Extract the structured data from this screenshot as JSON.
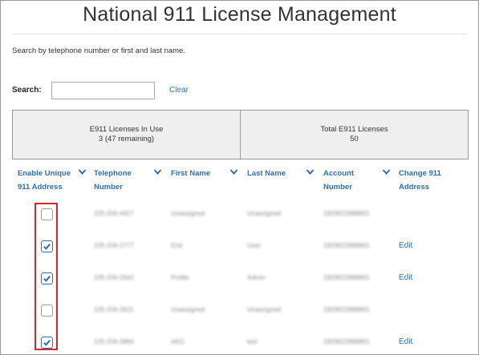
{
  "page": {
    "title": "National 911 License Management",
    "instructions": "Search by telephone number or first and last name."
  },
  "search": {
    "label": "Search:",
    "value": "",
    "placeholder": "",
    "clear_label": "Clear"
  },
  "stats": {
    "in_use_label": "E911 Licenses In Use",
    "in_use_value": "3 (47 remaining)",
    "total_label": "Total E911 Licenses",
    "total_value": "50"
  },
  "columns": {
    "enable_line1": "Enable Unique",
    "enable_line2": "911 Address",
    "phone_line1": "Telephone",
    "phone_line2": "Number",
    "first_name": "First Name",
    "last_name": "Last Name",
    "account_line1": "Account",
    "account_line2": "Number",
    "change_line1": "Change 911",
    "change_line2": "Address"
  },
  "rows": [
    {
      "checked": false,
      "phone": "225-256-4427",
      "first": "Unassigned",
      "last": "Unassigned",
      "account": "1829922988801",
      "edit": ""
    },
    {
      "checked": true,
      "phone": "225-256-2777",
      "first": "End",
      "last": "User",
      "account": "1829922988801",
      "edit": "Edit"
    },
    {
      "checked": true,
      "phone": "225-256-2642",
      "first": "Profile",
      "last": "Admin",
      "account": "1829922988801",
      "edit": "Edit"
    },
    {
      "checked": false,
      "phone": "225-256-3621",
      "first": "Unassigned",
      "last": "Unassigned",
      "account": "1829922988801",
      "edit": ""
    },
    {
      "checked": true,
      "phone": "225-256-3884",
      "first": "e911",
      "last": "test",
      "account": "1829922988801",
      "edit": "Edit"
    }
  ],
  "colors": {
    "link": "#2f6fb3",
    "checkbox_accent": "#2a6fb5",
    "highlight": "#d6262b",
    "stats_background": "#efefef"
  },
  "icons": {
    "sort": "chevron-down-icon",
    "checkbox": "checkmark-icon"
  }
}
